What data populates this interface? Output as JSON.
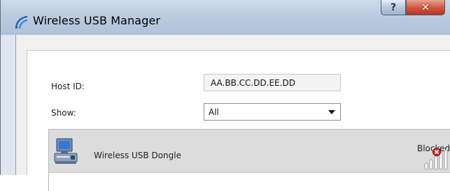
{
  "window": {
    "title": "Wireless USB Manager",
    "help_glyph": "?",
    "close_glyph": "✕"
  },
  "form": {
    "host_id_label": "Host ID:",
    "host_id_value": "AA.BB.CC.DD.EE.DD",
    "show_label": "Show:",
    "show_value": "All"
  },
  "devices": [
    {
      "name": "Wireless USB Dongle",
      "status": "Blocked",
      "icon": "computer-icon",
      "status_icon": "blocked-signal-icon"
    }
  ],
  "colors": {
    "titlebar": "#bccce0",
    "close_button": "#cf5b45",
    "selected_row": "#dcdcdc",
    "blocked_mark": "#d62828"
  }
}
